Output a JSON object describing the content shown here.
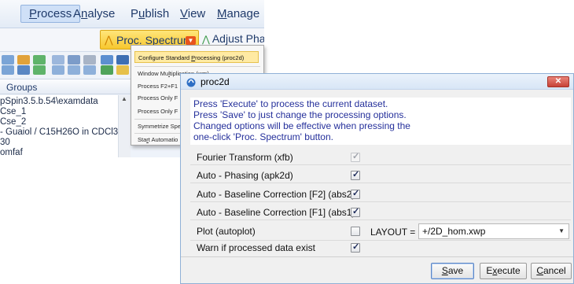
{
  "menubar": {
    "items": [
      {
        "pre": "",
        "mn": "P",
        "post": "rocess"
      },
      {
        "pre": "A",
        "mn": "n",
        "post": "alyse"
      },
      {
        "pre": "P",
        "mn": "u",
        "post": "blish"
      },
      {
        "pre": "",
        "mn": "V",
        "post": "iew"
      },
      {
        "pre": "",
        "mn": "M",
        "post": "anage"
      }
    ]
  },
  "ribbon": {
    "proc_spectrum_label": "Proc. Spectrum",
    "adjust_phase_label": "Adjust Pha"
  },
  "groups": {
    "label": "Groups",
    "tree_items": [
      "pSpin3.5.b.54\\examdata",
      "Cse_1",
      "Cse_2",
      "- Guaiol / C15H26O in CDCl3",
      "30",
      "omfaf"
    ]
  },
  "dropdown": {
    "items": [
      {
        "pre": "Configure Standard ",
        "mn": "P",
        "post": "rocessing (proc2d)"
      },
      {
        "pre": "Window Mu",
        "mn": "l",
        "post": "tiplication (wm)"
      },
      {
        "pre": "Process F2+F1",
        "mn": "",
        "post": ""
      },
      {
        "pre": "Process Only F",
        "mn": "",
        "post": ""
      },
      {
        "pre": "Process Only F",
        "mn": "",
        "post": ""
      },
      {
        "pre": "Symmetrize Spe",
        "mn": "",
        "post": ""
      },
      {
        "pre": "Sta",
        "mn": "r",
        "post": "t Automatio"
      }
    ]
  },
  "dialog": {
    "title": "proc2d",
    "info_lines": [
      "Press 'Execute' to process the current dataset.",
      "Press 'Save' to just change the processing options.",
      "Changed options will be effective when pressing the",
      "one-click 'Proc. Spectrum' button."
    ],
    "options": [
      {
        "label": "Fourier Transform (xfb)",
        "checked": true,
        "enabled": false
      },
      {
        "label": "Auto - Phasing (apk2d)",
        "checked": true,
        "enabled": true
      },
      {
        "label": "Auto - Baseline Correction [F2] (abs2)",
        "checked": true,
        "enabled": true
      },
      {
        "label": "Auto - Baseline Correction [F1] (abs1)",
        "checked": true,
        "enabled": true
      },
      {
        "label": "Plot (autoplot)",
        "checked": false,
        "enabled": true
      },
      {
        "label": "Warn if processed data exist",
        "checked": true,
        "enabled": true
      }
    ],
    "layout_label": "LAYOUT =",
    "layout_value": "+/2D_hom.xwp",
    "buttons": {
      "save": {
        "mn": "S",
        "post": "ave"
      },
      "execute": {
        "pre": "E",
        "mn": "x",
        "post": "ecute"
      },
      "cancel": {
        "mn": "C",
        "post": "ancel"
      }
    }
  },
  "colors": {
    "accent_yellow": "#f7c72e",
    "info_text": "#25309b",
    "close_red": "#c74237",
    "menu_text": "#1f3a6a"
  }
}
